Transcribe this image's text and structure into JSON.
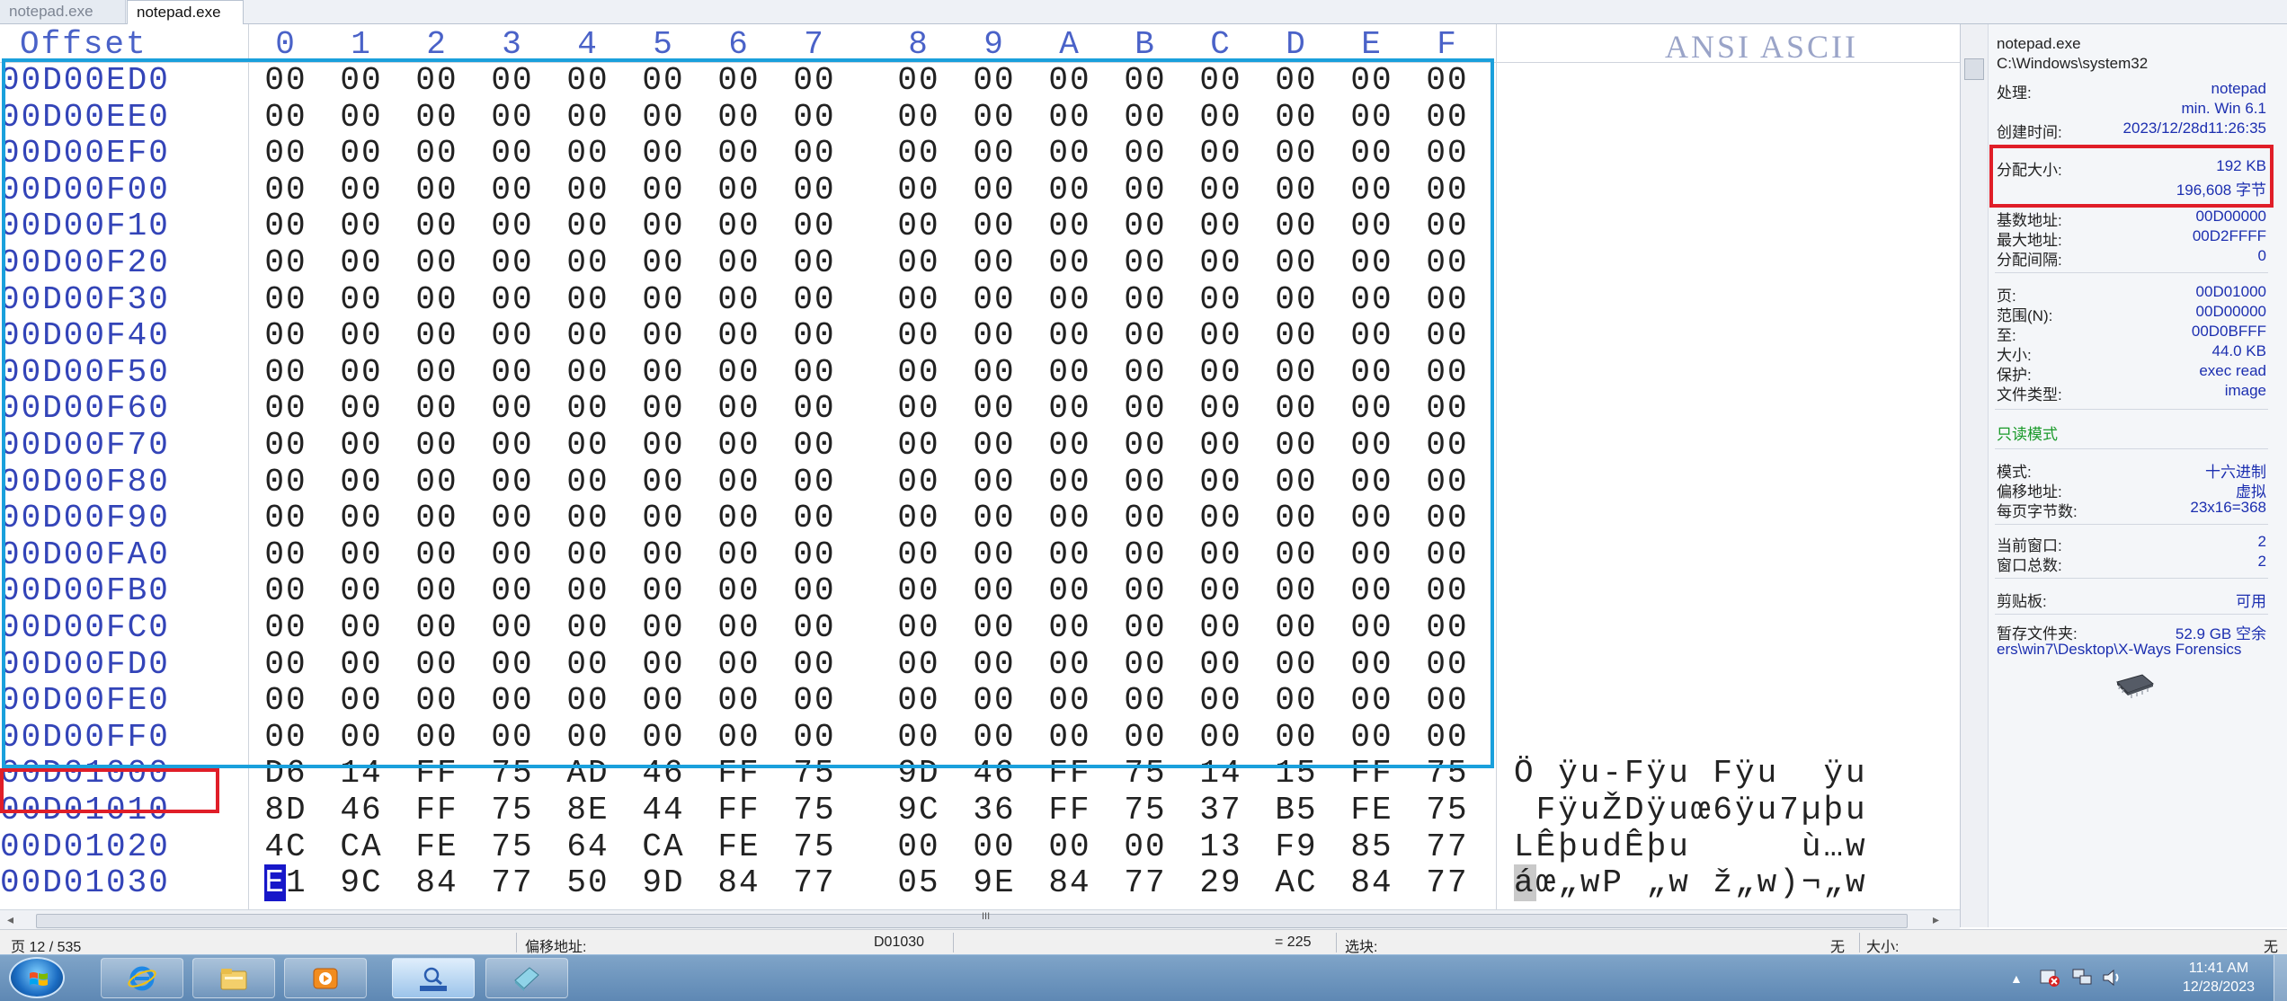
{
  "tabs": [
    {
      "label": "notepad.exe",
      "active": false
    },
    {
      "label": "notepad.exe",
      "active": true
    }
  ],
  "hex": {
    "offset_header": "Offset",
    "column_headers": [
      "0",
      "1",
      "2",
      "3",
      "4",
      "5",
      "6",
      "7",
      "8",
      "9",
      "A",
      "B",
      "C",
      "D",
      "E",
      "F"
    ],
    "ascii_header": "ANSI ASCII",
    "rows": [
      {
        "offset": "00D00ED0",
        "bytes": [
          "00",
          "00",
          "00",
          "00",
          "00",
          "00",
          "00",
          "00",
          "00",
          "00",
          "00",
          "00",
          "00",
          "00",
          "00",
          "00"
        ],
        "ascii": ""
      },
      {
        "offset": "00D00EE0",
        "bytes": [
          "00",
          "00",
          "00",
          "00",
          "00",
          "00",
          "00",
          "00",
          "00",
          "00",
          "00",
          "00",
          "00",
          "00",
          "00",
          "00"
        ],
        "ascii": ""
      },
      {
        "offset": "00D00EF0",
        "bytes": [
          "00",
          "00",
          "00",
          "00",
          "00",
          "00",
          "00",
          "00",
          "00",
          "00",
          "00",
          "00",
          "00",
          "00",
          "00",
          "00"
        ],
        "ascii": ""
      },
      {
        "offset": "00D00F00",
        "bytes": [
          "00",
          "00",
          "00",
          "00",
          "00",
          "00",
          "00",
          "00",
          "00",
          "00",
          "00",
          "00",
          "00",
          "00",
          "00",
          "00"
        ],
        "ascii": ""
      },
      {
        "offset": "00D00F10",
        "bytes": [
          "00",
          "00",
          "00",
          "00",
          "00",
          "00",
          "00",
          "00",
          "00",
          "00",
          "00",
          "00",
          "00",
          "00",
          "00",
          "00"
        ],
        "ascii": ""
      },
      {
        "offset": "00D00F20",
        "bytes": [
          "00",
          "00",
          "00",
          "00",
          "00",
          "00",
          "00",
          "00",
          "00",
          "00",
          "00",
          "00",
          "00",
          "00",
          "00",
          "00"
        ],
        "ascii": ""
      },
      {
        "offset": "00D00F30",
        "bytes": [
          "00",
          "00",
          "00",
          "00",
          "00",
          "00",
          "00",
          "00",
          "00",
          "00",
          "00",
          "00",
          "00",
          "00",
          "00",
          "00"
        ],
        "ascii": ""
      },
      {
        "offset": "00D00F40",
        "bytes": [
          "00",
          "00",
          "00",
          "00",
          "00",
          "00",
          "00",
          "00",
          "00",
          "00",
          "00",
          "00",
          "00",
          "00",
          "00",
          "00"
        ],
        "ascii": ""
      },
      {
        "offset": "00D00F50",
        "bytes": [
          "00",
          "00",
          "00",
          "00",
          "00",
          "00",
          "00",
          "00",
          "00",
          "00",
          "00",
          "00",
          "00",
          "00",
          "00",
          "00"
        ],
        "ascii": ""
      },
      {
        "offset": "00D00F60",
        "bytes": [
          "00",
          "00",
          "00",
          "00",
          "00",
          "00",
          "00",
          "00",
          "00",
          "00",
          "00",
          "00",
          "00",
          "00",
          "00",
          "00"
        ],
        "ascii": ""
      },
      {
        "offset": "00D00F70",
        "bytes": [
          "00",
          "00",
          "00",
          "00",
          "00",
          "00",
          "00",
          "00",
          "00",
          "00",
          "00",
          "00",
          "00",
          "00",
          "00",
          "00"
        ],
        "ascii": ""
      },
      {
        "offset": "00D00F80",
        "bytes": [
          "00",
          "00",
          "00",
          "00",
          "00",
          "00",
          "00",
          "00",
          "00",
          "00",
          "00",
          "00",
          "00",
          "00",
          "00",
          "00"
        ],
        "ascii": ""
      },
      {
        "offset": "00D00F90",
        "bytes": [
          "00",
          "00",
          "00",
          "00",
          "00",
          "00",
          "00",
          "00",
          "00",
          "00",
          "00",
          "00",
          "00",
          "00",
          "00",
          "00"
        ],
        "ascii": ""
      },
      {
        "offset": "00D00FA0",
        "bytes": [
          "00",
          "00",
          "00",
          "00",
          "00",
          "00",
          "00",
          "00",
          "00",
          "00",
          "00",
          "00",
          "00",
          "00",
          "00",
          "00"
        ],
        "ascii": ""
      },
      {
        "offset": "00D00FB0",
        "bytes": [
          "00",
          "00",
          "00",
          "00",
          "00",
          "00",
          "00",
          "00",
          "00",
          "00",
          "00",
          "00",
          "00",
          "00",
          "00",
          "00"
        ],
        "ascii": ""
      },
      {
        "offset": "00D00FC0",
        "bytes": [
          "00",
          "00",
          "00",
          "00",
          "00",
          "00",
          "00",
          "00",
          "00",
          "00",
          "00",
          "00",
          "00",
          "00",
          "00",
          "00"
        ],
        "ascii": ""
      },
      {
        "offset": "00D00FD0",
        "bytes": [
          "00",
          "00",
          "00",
          "00",
          "00",
          "00",
          "00",
          "00",
          "00",
          "00",
          "00",
          "00",
          "00",
          "00",
          "00",
          "00"
        ],
        "ascii": ""
      },
      {
        "offset": "00D00FE0",
        "bytes": [
          "00",
          "00",
          "00",
          "00",
          "00",
          "00",
          "00",
          "00",
          "00",
          "00",
          "00",
          "00",
          "00",
          "00",
          "00",
          "00"
        ],
        "ascii": ""
      },
      {
        "offset": "00D00FF0",
        "bytes": [
          "00",
          "00",
          "00",
          "00",
          "00",
          "00",
          "00",
          "00",
          "00",
          "00",
          "00",
          "00",
          "00",
          "00",
          "00",
          "00"
        ],
        "ascii": ""
      },
      {
        "offset": "00D01000",
        "bytes": [
          "D6",
          "14",
          "FF",
          "75",
          "AD",
          "46",
          "FF",
          "75",
          "9D",
          "46",
          "FF",
          "75",
          "14",
          "15",
          "FF",
          "75"
        ],
        "ascii": "Ö ÿu-Fÿu Fÿu  ÿu"
      },
      {
        "offset": "00D01010",
        "bytes": [
          "8D",
          "46",
          "FF",
          "75",
          "8E",
          "44",
          "FF",
          "75",
          "9C",
          "36",
          "FF",
          "75",
          "37",
          "B5",
          "FE",
          "75"
        ],
        "ascii": " FÿuŽDÿuœ6ÿu7µþu"
      },
      {
        "offset": "00D01020",
        "bytes": [
          "4C",
          "CA",
          "FE",
          "75",
          "64",
          "CA",
          "FE",
          "75",
          "00",
          "00",
          "00",
          "00",
          "13",
          "F9",
          "85",
          "77"
        ],
        "ascii": "LÊþudÊþu     ù…w"
      },
      {
        "offset": "00D01030",
        "bytes": [
          "E1",
          "9C",
          "84",
          "77",
          "50",
          "9D",
          "84",
          "77",
          "05",
          "9E",
          "84",
          "77",
          "29",
          "AC",
          "84",
          "77"
        ],
        "ascii": "áœ„wP „w ž„w)¬„w"
      }
    ],
    "cursor": {
      "row": 22,
      "col": 0,
      "nibble": "E"
    }
  },
  "panel": {
    "file_name": "notepad.exe",
    "file_path": "C:\\Windows\\system32",
    "process_label": "处理:",
    "process_value": "notepad",
    "os_value": "min. Win 6.1",
    "created_label": "创建时间:",
    "created_value": "2023/12/28d11:26:35",
    "alloc_size_label": "分配大小:",
    "alloc_size_kb": "192 KB",
    "alloc_size_bytes": "196,608 字节",
    "base_addr_label": "基数地址:",
    "base_addr_value": "00D00000",
    "max_addr_label": "最大地址:",
    "max_addr_value": "00D2FFFF",
    "alloc_gran_label": "分配间隔:",
    "alloc_gran_value": "0",
    "page_label": "页:",
    "page_value": "00D01000",
    "range_label": "范围(N):",
    "range_value": "00D00000",
    "to_label": "至:",
    "to_value": "00D0BFFF",
    "size_label": "大小:",
    "size_value": "44.0 KB",
    "protect_label": "保护:",
    "protect_value": "exec read",
    "filetype_label": "文件类型:",
    "filetype_value": "image",
    "readonly_label": "只读模式",
    "mode_label": "模式:",
    "mode_value": "十六进制",
    "offset_label": "偏移地址:",
    "offset_value": "虚拟",
    "bpp_label": "每页字节数:",
    "bpp_value": "23x16=368",
    "cur_window_label": "当前窗口:",
    "cur_window_value": "2",
    "win_total_label": "窗口总数:",
    "win_total_value": "2",
    "clipboard_label": "剪贴板:",
    "clipboard_value": "可用",
    "temp_label": "暂存文件夹:",
    "temp_value": "52.9 GB 空余",
    "temp_path": "ers\\win7\\Desktop\\X-Ways Forensics",
    "chip_icon": "memory-chip-icon"
  },
  "statusbar": {
    "page": "页 12 / 535",
    "offset_label": "偏移地址:",
    "offset_value": "D01030",
    "value": "= 225",
    "block_label": "选块:",
    "block_value": "无",
    "size_label": "大小:",
    "size_value": "无"
  },
  "taskbar": {
    "apps": [
      "internet-explorer-icon",
      "file-explorer-icon",
      "media-player-icon",
      "hex-editor-icon",
      "notepad-icon"
    ],
    "time": "11:41 AM",
    "date": "12/28/2023"
  },
  "colors": {
    "offset_blue": "#3344b8",
    "selection_box": "#1aa0dc",
    "highlight_red": "#e01e28",
    "readonly_green": "#1a9a2a",
    "value_blue": "#1c2fb0"
  }
}
